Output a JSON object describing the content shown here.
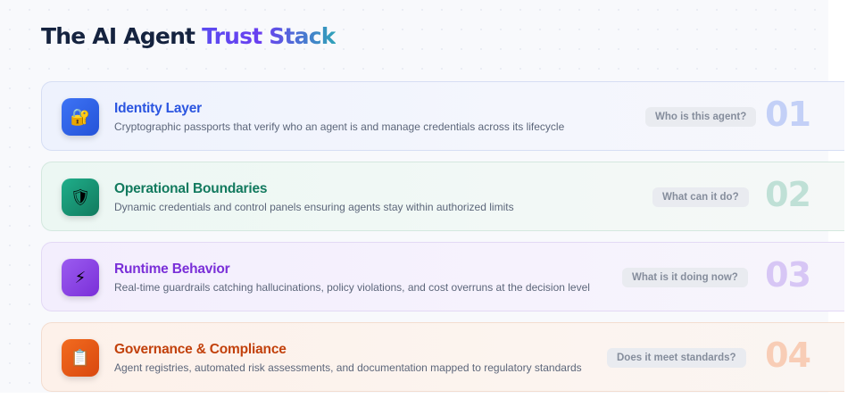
{
  "header": {
    "title_main": "The AI Agent",
    "title_accent": "Trust Stack"
  },
  "layers": [
    {
      "title": "Identity Layer",
      "description": "Cryptographic passports that verify who an agent is and manage credentials across its lifecycle",
      "question": "Who is this agent?",
      "number": "01",
      "icon": "lock-key-icon",
      "icon_glyph": "🔐",
      "color": "#2b55e0"
    },
    {
      "title": "Operational Boundaries",
      "description": "Dynamic credentials and control panels ensuring agents stay within authorized limits",
      "question": "What can it do?",
      "number": "02",
      "icon": "shield-icon",
      "icon_glyph": "🛡",
      "color": "#127a5e"
    },
    {
      "title": "Runtime Behavior",
      "description": "Real-time guardrails catching hallucinations, policy violations, and cost overruns at the decision level",
      "question": "What is it doing now?",
      "number": "03",
      "icon": "lightning-icon",
      "icon_glyph": "⚡",
      "color": "#7a2fd8"
    },
    {
      "title": "Governance & Compliance",
      "description": "Agent registries, automated risk assessments, and documentation mapped to regulatory standards",
      "question": "Does it meet standards?",
      "number": "04",
      "icon": "clipboard-icon",
      "icon_glyph": "📋",
      "color": "#c2410c"
    }
  ]
}
